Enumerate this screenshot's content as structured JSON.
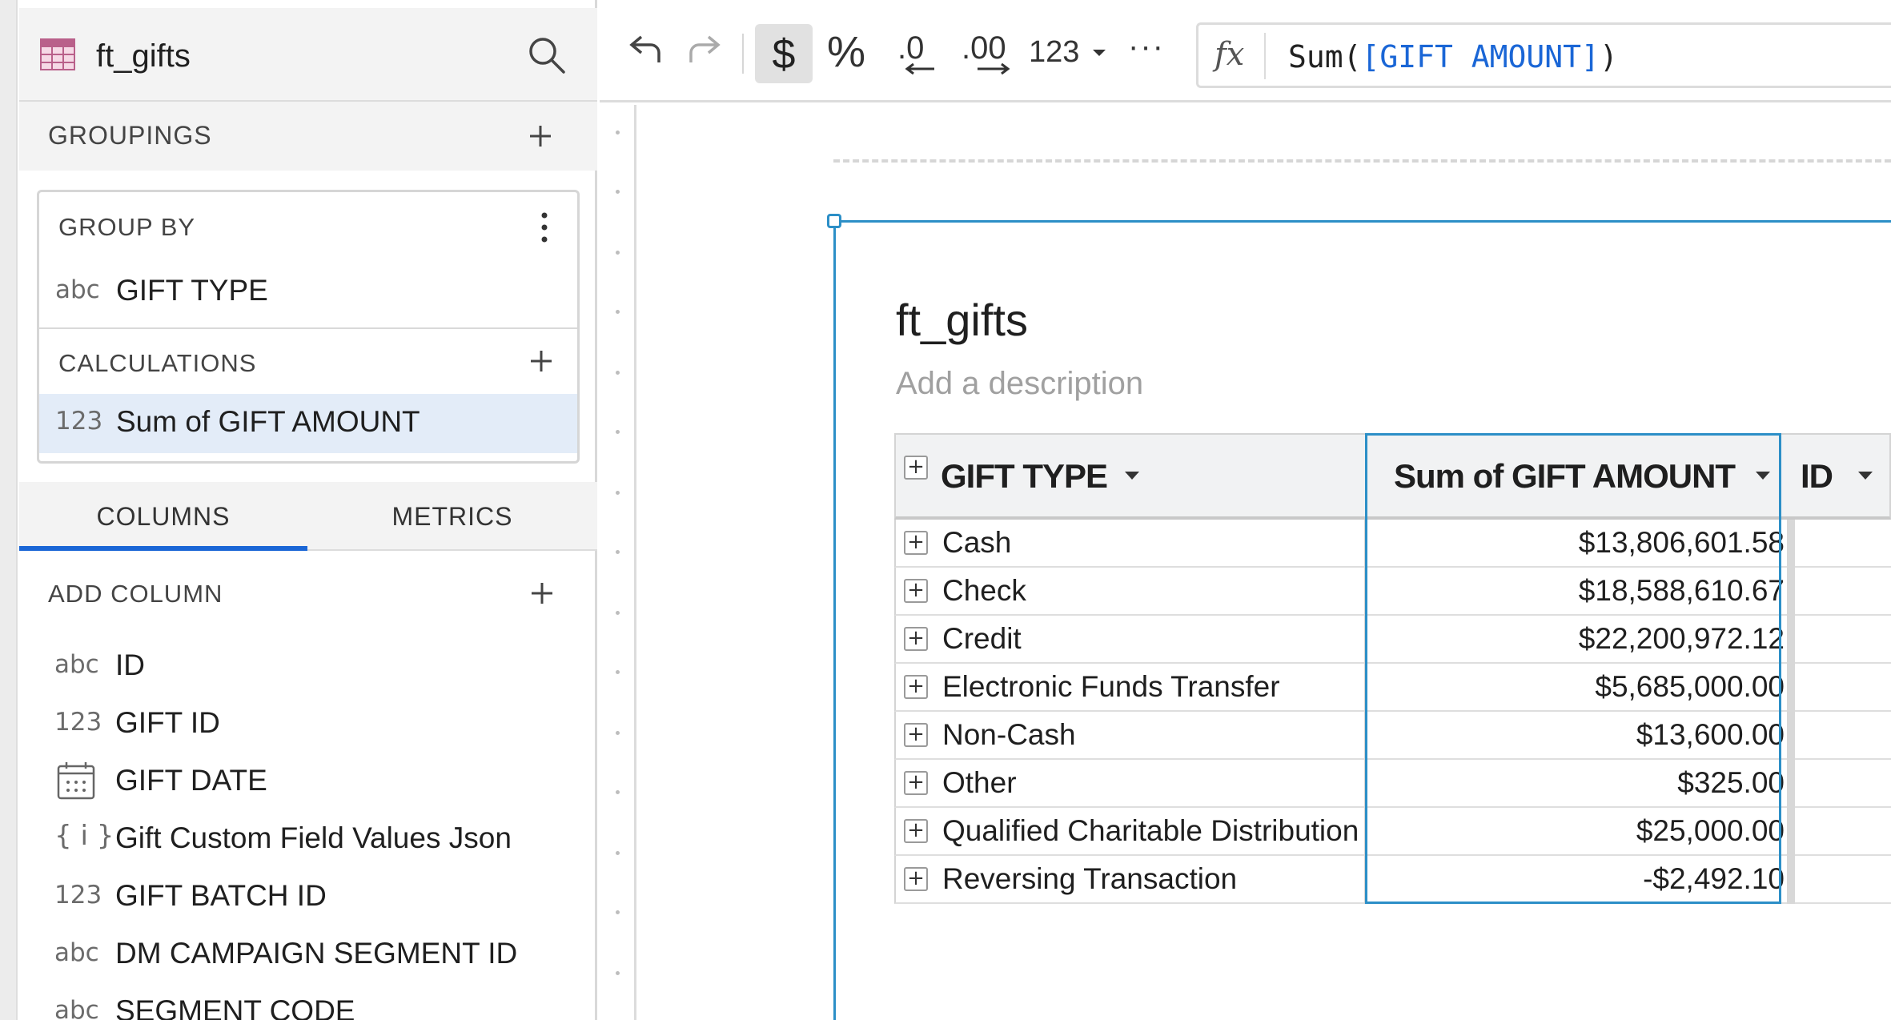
{
  "left_panel": {
    "title": "ft_gifts",
    "groupings_label": "GROUPINGS",
    "group_by_label": "GROUP BY",
    "group_by_field": {
      "type": "abc",
      "name": "GIFT TYPE"
    },
    "calculations_label": "CALCULATIONS",
    "calculation_field": {
      "type": "123",
      "name": "Sum of GIFT AMOUNT"
    },
    "tabs": [
      {
        "label": "COLUMNS",
        "active": true
      },
      {
        "label": "METRICS",
        "active": false
      }
    ],
    "add_column_label": "ADD COLUMN",
    "columns": [
      {
        "type": "abc",
        "name": "ID"
      },
      {
        "type": "123",
        "name": "GIFT ID"
      },
      {
        "type": "calendar-icon",
        "name": "GIFT DATE"
      },
      {
        "type": "{ i }",
        "name": "Gift Custom Field Values Json"
      },
      {
        "type": "123",
        "name": "GIFT BATCH ID"
      },
      {
        "type": "abc",
        "name": "DM CAMPAIGN SEGMENT ID"
      },
      {
        "type": "abc",
        "name": "SEGMENT CODE"
      }
    ]
  },
  "toolbar": {
    "currency_symbol": "$",
    "percent_symbol": "%",
    "decrease_decimals": ".0",
    "increase_decimals": ".00",
    "number_format_label": "123",
    "more_label": "···",
    "fx_label": "fx",
    "formula_prefix": "Sum(",
    "formula_ref": "[GIFT AMOUNT]",
    "formula_suffix": ")"
  },
  "element": {
    "title": "ft_gifts",
    "description_placeholder": "Add a description",
    "columns": [
      "GIFT TYPE",
      "Sum of GIFT AMOUNT",
      "ID"
    ],
    "rows": [
      {
        "gift_type": "Cash",
        "sum": "$13,806,601.58"
      },
      {
        "gift_type": "Check",
        "sum": "$18,588,610.67"
      },
      {
        "gift_type": "Credit",
        "sum": "$22,200,972.12"
      },
      {
        "gift_type": "Electronic Funds Transfer",
        "sum": "$5,685,000.00"
      },
      {
        "gift_type": "Non-Cash",
        "sum": "$13,600.00"
      },
      {
        "gift_type": "Other",
        "sum": "$325.00"
      },
      {
        "gift_type": "Qualified Charitable Distribution",
        "sum": "$25,000.00"
      },
      {
        "gift_type": "Reversing Transaction",
        "sum": "-$2,492.10"
      }
    ]
  },
  "colors": {
    "accent_blue": "#1a66d6",
    "selection_blue": "#2c8fc7",
    "selected_row": "#e3ecf8",
    "panel_grey": "#f3f3f3"
  }
}
